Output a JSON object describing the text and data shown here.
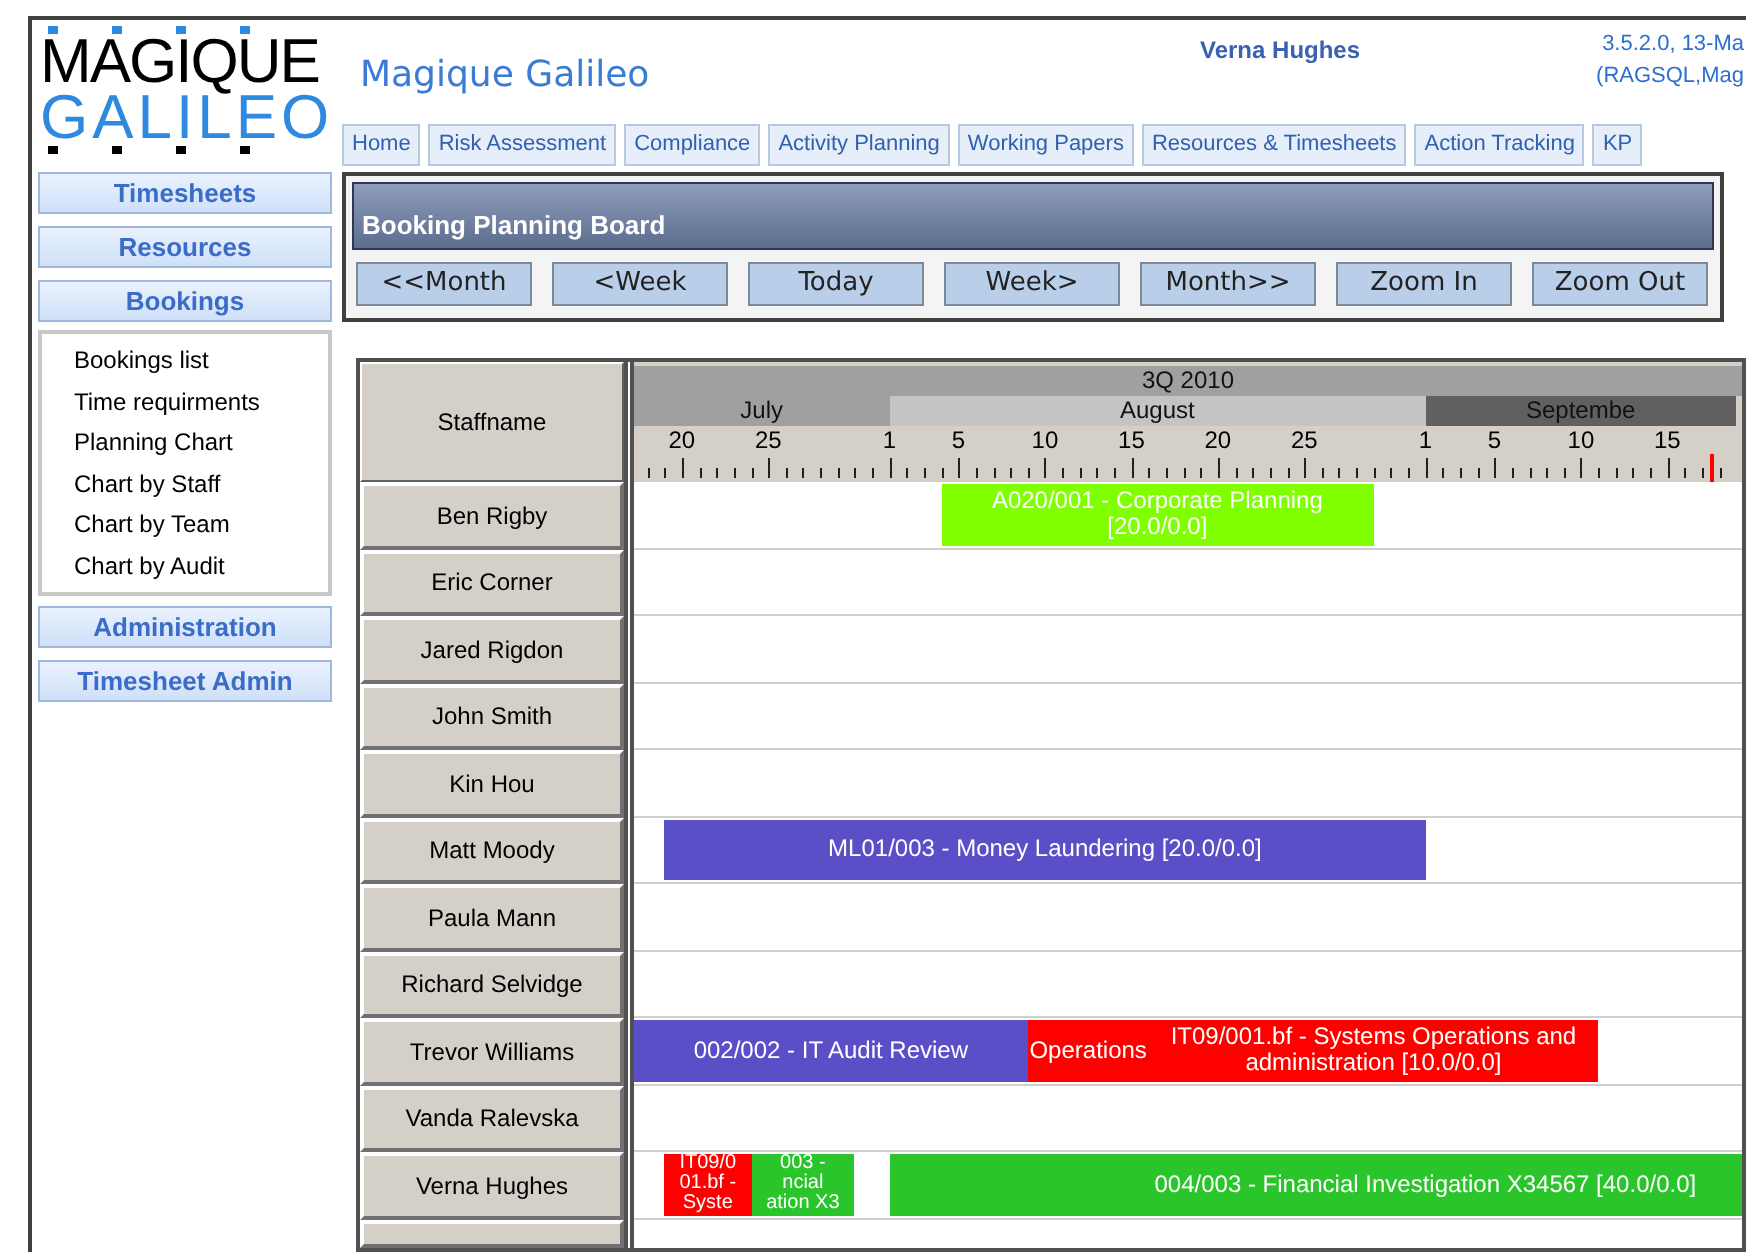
{
  "header": {
    "logo_top": "MAGIQUE",
    "logo_bottom": "GALILEO",
    "app_title": "Magique Galileo",
    "user": "Verna Hughes",
    "version_lines": [
      "3.5.2.0, 13-Ma",
      "(RAGSQL,Mag"
    ]
  },
  "tabs": [
    "Home",
    "Risk Assessment",
    "Compliance",
    "Activity Planning",
    "Working Papers",
    "Resources & Timesheets",
    "Action Tracking",
    "KP"
  ],
  "sidebar": [
    {
      "kind": "button",
      "label": "Timesheets"
    },
    {
      "kind": "button",
      "label": "Resources"
    },
    {
      "kind": "button",
      "label": "Bookings"
    },
    {
      "kind": "submenu",
      "items": [
        "Bookings list",
        "Time requirments",
        "Planning Chart",
        "Chart by Staff",
        "Chart by Team",
        "Chart by Audit"
      ]
    },
    {
      "kind": "button",
      "label": "Administration"
    },
    {
      "kind": "button",
      "label": "Timesheet Admin"
    }
  ],
  "board": {
    "title": "Booking Planning Board",
    "buttons": [
      "<<Month",
      "<Week",
      "Today",
      "Week>",
      "Month>>",
      "Zoom In",
      "Zoom Out"
    ]
  },
  "gantt": {
    "staff_heading": "Staffname",
    "quarter": "3Q 2010",
    "months": [
      {
        "label": "July",
        "color": "#a0a0a0"
      },
      {
        "label": "August",
        "color": "#c4c4c4"
      },
      {
        "label": "Septembe",
        "color": "#606060"
      }
    ],
    "day_labels": [
      "20",
      "25",
      "1",
      "5",
      "10",
      "15",
      "20",
      "25",
      "1",
      "5",
      "10",
      "15"
    ],
    "rows": [
      {
        "name": "Ben Rigby",
        "bookings": [
          {
            "lines": [
              "A020/001 - Corporate Planning",
              "[20.0/0.0]"
            ],
            "color": "#80ff00"
          }
        ]
      },
      {
        "name": "Eric Corner",
        "bookings": []
      },
      {
        "name": "Jared Rigdon",
        "bookings": []
      },
      {
        "name": "John Smith",
        "bookings": []
      },
      {
        "name": "Kin Hou",
        "bookings": []
      },
      {
        "name": "Matt Moody",
        "bookings": [
          {
            "lines": [
              "ML01/003 - Money Laundering [20.0/0.0]"
            ],
            "color": "#5b4fc8"
          }
        ]
      },
      {
        "name": "Paula Mann",
        "bookings": []
      },
      {
        "name": "Richard Selvidge",
        "bookings": []
      },
      {
        "name": "Trevor Williams",
        "bookings": [
          {
            "lines": [
              "002/002 - IT Audit Review"
            ],
            "color": "#5b4fc8"
          },
          {
            "lines": [
              "Operations"
            ],
            "color": "#ff0000"
          },
          {
            "lines": [
              "IT09/001.bf - Systems Operations and",
              "administration [10.0/0.0]"
            ],
            "color": "#ff0000"
          }
        ]
      },
      {
        "name": "Vanda Ralevska",
        "bookings": []
      },
      {
        "name": "Verna Hughes",
        "bookings": [
          {
            "lines": [
              "IT09/0",
              "01.bf -",
              "Syste"
            ],
            "color": "#ff0000"
          },
          {
            "lines": [
              "003 -",
              "ncial",
              "ation X3"
            ],
            "color": "#2ac52a"
          },
          {
            "lines": [
              "004/003 - Financial Investigation  X34567 [40.0/0.0]"
            ],
            "color": "#2ac52a"
          }
        ]
      }
    ]
  }
}
